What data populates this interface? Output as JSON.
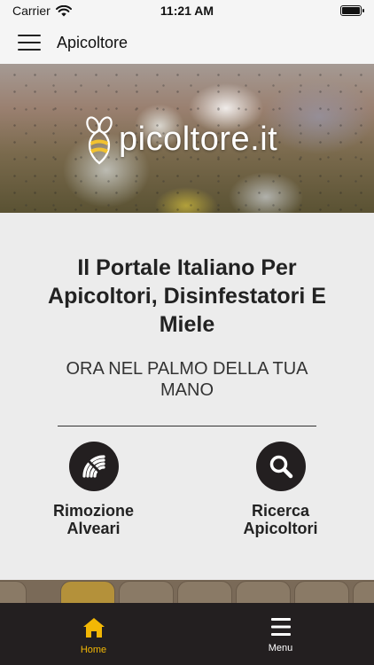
{
  "status_bar": {
    "carrier": "Carrier",
    "time": "11:21 AM",
    "battery_level": 1.0
  },
  "header": {
    "title": "Apicoltore",
    "menu_icon": "hamburger-icon"
  },
  "hero": {
    "logo_text": "picoltore.it",
    "logo_icon": "bee-icon"
  },
  "main": {
    "title": "Il Portale Italiano Per Apicoltori, Disinfestatori E Miele",
    "subtitle": "ORA NEL PALMO DELLA TUA MANO"
  },
  "actions": [
    {
      "label": "Rimozione Alveari",
      "icon": "hive-removal-icon"
    },
    {
      "label": "Ricerca Apicoltori",
      "icon": "search-icon"
    }
  ],
  "bottom_nav": {
    "items": [
      {
        "label": "Home",
        "icon": "home-icon",
        "active": true
      },
      {
        "label": "Menu",
        "icon": "menu-icon",
        "active": false
      }
    ]
  },
  "colors": {
    "accent": "#f2b705",
    "dark": "#231f20",
    "background": "#ececec"
  }
}
